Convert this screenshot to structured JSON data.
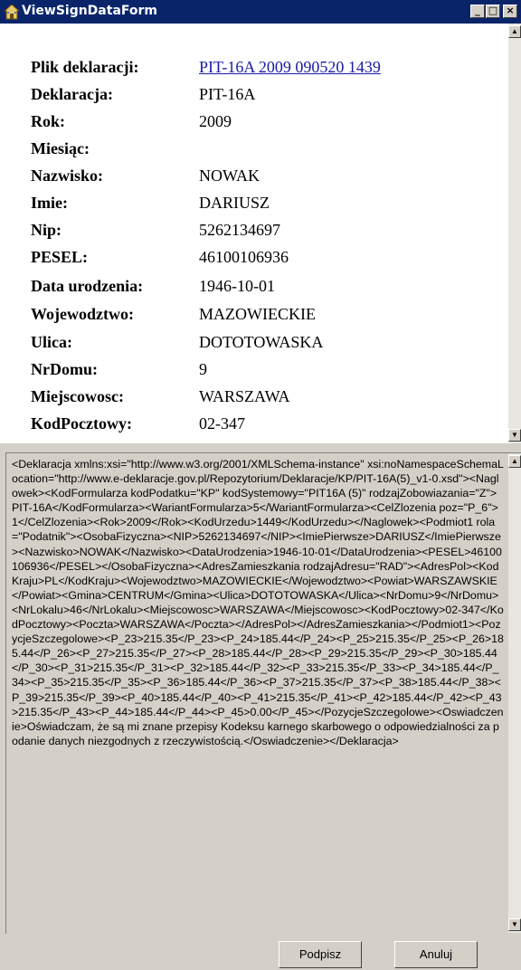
{
  "window": {
    "title": "ViewSignDataForm",
    "icon": "home-icon",
    "controls": {
      "minimize": "_",
      "maximize": "□",
      "close": "×"
    }
  },
  "declaration": {
    "rows": [
      {
        "label": "Plik deklaracji:",
        "value": "PIT-16A 2009 090520 1439",
        "link": true
      },
      {
        "label": "Deklaracja:",
        "value": "PIT-16A"
      },
      {
        "label": "Rok:",
        "value": "2009"
      },
      {
        "label": "Miesiąc:",
        "value": ""
      },
      {
        "label": "Nazwisko:",
        "value": "NOWAK"
      },
      {
        "label": "Imie:",
        "value": "DARIUSZ"
      },
      {
        "label": "Nip:",
        "value": "5262134697"
      },
      {
        "label": "PESEL:",
        "value": "46100106936"
      },
      {
        "label": "Data urodzenia:",
        "value": "1946-10-01"
      },
      {
        "label": "Wojewodztwo:",
        "value": "MAZOWIECKIE"
      },
      {
        "label": "Ulica:",
        "value": "DOTOTOWASKA"
      },
      {
        "label": "NrDomu:",
        "value": "9"
      },
      {
        "label": "Miejscowosc:",
        "value": "WARSZAWA"
      },
      {
        "label": "KodPocztowy:",
        "value": "02-347"
      }
    ]
  },
  "xml": {
    "content": "<Deklaracja xmlns:xsi=\"http://www.w3.org/2001/XMLSchema-instance\" xsi:noNamespaceSchemaLocation=\"http://www.e-deklaracje.gov.pl/Repozytorium/Deklaracje/KP/PIT-16A(5)_v1-0.xsd\"><Naglowek><KodFormularza kodPodatku=\"KP\" kodSystemowy=\"PIT16A (5)\" rodzajZobowiazania=\"Z\">PIT-16A</KodFormularza><WariantFormularza>5</WariantFormularza><CelZlozenia poz=\"P_6\">1</CelZlozenia><Rok>2009</Rok><KodUrzedu>1449</KodUrzedu></Naglowek><Podmiot1 rola=\"Podatnik\"><OsobaFizyczna><NIP>5262134697</NIP><ImiePierwsze>DARIUSZ</ImiePierwsze><Nazwisko>NOWAK</Nazwisko><DataUrodzenia>1946-10-01</DataUrodzenia><PESEL>46100106936</PESEL></OsobaFizyczna><AdresZamieszkania rodzajAdresu=\"RAD\"><AdresPol><KodKraju>PL</KodKraju><Wojewodztwo>MAZOWIECKIE</Wojewodztwo><Powiat>WARSZAWSKIE</Powiat><Gmina>CENTRUM</Gmina><Ulica>DOTOTOWASKA</Ulica><NrDomu>9</NrDomu><NrLokalu>46</NrLokalu><Miejscowosc>WARSZAWA</Miejscowosc><KodPocztowy>02-347</KodPocztowy><Poczta>WARSZAWA</Poczta></AdresPol></AdresZamieszkania></Podmiot1><PozycjeSzczegolowe><P_23>215.35</P_23><P_24>185.44</P_24><P_25>215.35</P_25><P_26>185.44</P_26><P_27>215.35</P_27><P_28>185.44</P_28><P_29>215.35</P_29><P_30>185.44</P_30><P_31>215.35</P_31><P_32>185.44</P_32><P_33>215.35</P_33><P_34>185.44</P_34><P_35>215.35</P_35><P_36>185.44</P_36><P_37>215.35</P_37><P_38>185.44</P_38><P_39>215.35</P_39><P_40>185.44</P_40><P_41>215.35</P_41><P_42>185.44</P_42><P_43>215.35</P_43><P_44>185.44</P_44><P_45>0.00</P_45></PozycjeSzczegolowe><Oswiadczenie>Oświadczam, że są mi znane przepisy Kodeksu karnego skarbowego o odpowiedzialności za podanie danych niezgodnych z rzeczywistością.</Oswiadczenie></Deklaracja>"
  },
  "buttons": {
    "sign": "Podpisz",
    "cancel": "Anuluj"
  },
  "scroll_icons": {
    "up": "▲",
    "down": "▼"
  },
  "colors": {
    "titlebar": "#0a246a",
    "link": "#1a1aa6",
    "face": "#d4d0c8"
  }
}
